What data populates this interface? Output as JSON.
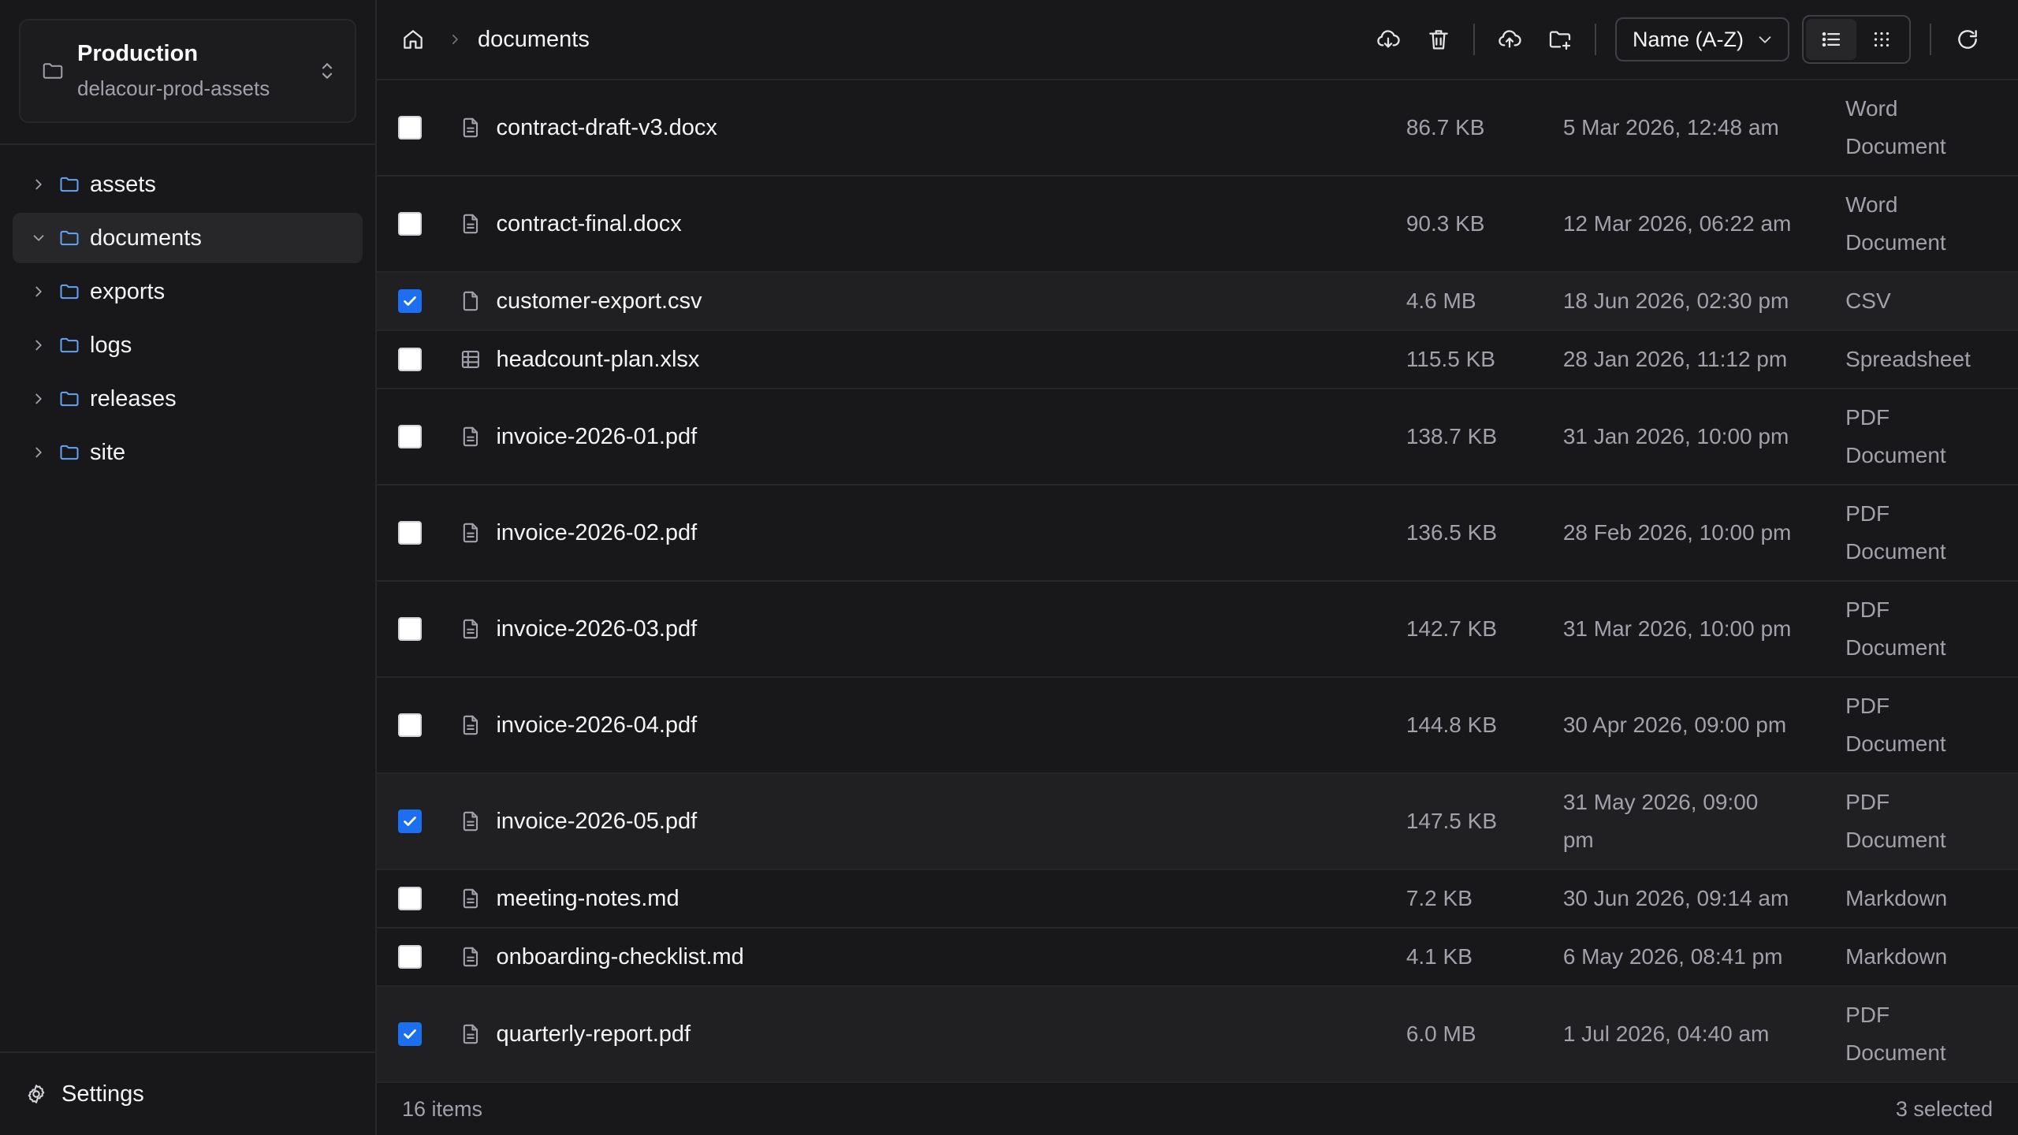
{
  "bucket": {
    "name": "Production",
    "id": "delacour-prod-assets"
  },
  "tree": [
    {
      "label": "assets",
      "expanded": false,
      "active": false
    },
    {
      "label": "documents",
      "expanded": true,
      "active": true
    },
    {
      "label": "exports",
      "expanded": false,
      "active": false
    },
    {
      "label": "logs",
      "expanded": false,
      "active": false
    },
    {
      "label": "releases",
      "expanded": false,
      "active": false
    },
    {
      "label": "site",
      "expanded": false,
      "active": false
    }
  ],
  "settings_label": "Settings",
  "breadcrumb": {
    "current": "documents"
  },
  "sort": {
    "label": "Name (A-Z)"
  },
  "view_mode": "list",
  "files": [
    {
      "name": "contract-draft-v3.docx",
      "icon": "document-icon",
      "size": "86.7 KB",
      "date": [
        "5 Mar 2026, 12:48 am"
      ],
      "type": [
        "Word",
        "Document"
      ],
      "checked": false
    },
    {
      "name": "contract-final.docx",
      "icon": "document-icon",
      "size": "90.3 KB",
      "date": [
        "12 Mar 2026, 06:22 am"
      ],
      "type": [
        "Word",
        "Document"
      ],
      "checked": false
    },
    {
      "name": "customer-export.csv",
      "icon": "file-icon",
      "size": "4.6 MB",
      "date": [
        "18 Jun 2026, 02:30 pm"
      ],
      "type": [
        "CSV"
      ],
      "checked": true
    },
    {
      "name": "headcount-plan.xlsx",
      "icon": "spreadsheet-icon",
      "size": "115.5 KB",
      "date": [
        "28 Jan 2026, 11:12 pm"
      ],
      "type": [
        "Spreadsheet"
      ],
      "checked": false
    },
    {
      "name": "invoice-2026-01.pdf",
      "icon": "document-icon",
      "size": "138.7 KB",
      "date": [
        "31 Jan 2026, 10:00 pm"
      ],
      "type": [
        "PDF",
        "Document"
      ],
      "checked": false
    },
    {
      "name": "invoice-2026-02.pdf",
      "icon": "document-icon",
      "size": "136.5 KB",
      "date": [
        "28 Feb 2026, 10:00 pm"
      ],
      "type": [
        "PDF",
        "Document"
      ],
      "checked": false
    },
    {
      "name": "invoice-2026-03.pdf",
      "icon": "document-icon",
      "size": "142.7 KB",
      "date": [
        "31 Mar 2026, 10:00 pm"
      ],
      "type": [
        "PDF",
        "Document"
      ],
      "checked": false
    },
    {
      "name": "invoice-2026-04.pdf",
      "icon": "document-icon",
      "size": "144.8 KB",
      "date": [
        "30 Apr 2026, 09:00 pm"
      ],
      "type": [
        "PDF",
        "Document"
      ],
      "checked": false
    },
    {
      "name": "invoice-2026-05.pdf",
      "icon": "document-icon",
      "size": "147.5 KB",
      "date": [
        "31 May 2026, 09:00",
        "pm"
      ],
      "type": [
        "PDF",
        "Document"
      ],
      "checked": true
    },
    {
      "name": "meeting-notes.md",
      "icon": "document-icon",
      "size": "7.2 KB",
      "date": [
        "30 Jun 2026, 09:14 am"
      ],
      "type": [
        "Markdown"
      ],
      "checked": false
    },
    {
      "name": "onboarding-checklist.md",
      "icon": "document-icon",
      "size": "4.1 KB",
      "date": [
        "6 May 2026, 08:41 pm"
      ],
      "type": [
        "Markdown"
      ],
      "checked": false
    },
    {
      "name": "quarterly-report.pdf",
      "icon": "document-icon",
      "size": "6.0 MB",
      "date": [
        "1 Jul 2026, 04:40 am"
      ],
      "type": [
        "PDF",
        "Document"
      ],
      "checked": true
    }
  ],
  "status": {
    "count": "16 items",
    "selected": "3 selected"
  },
  "colors": {
    "accent": "#1d6ff2",
    "folder": "#60a5fa",
    "background": "#18181b"
  }
}
